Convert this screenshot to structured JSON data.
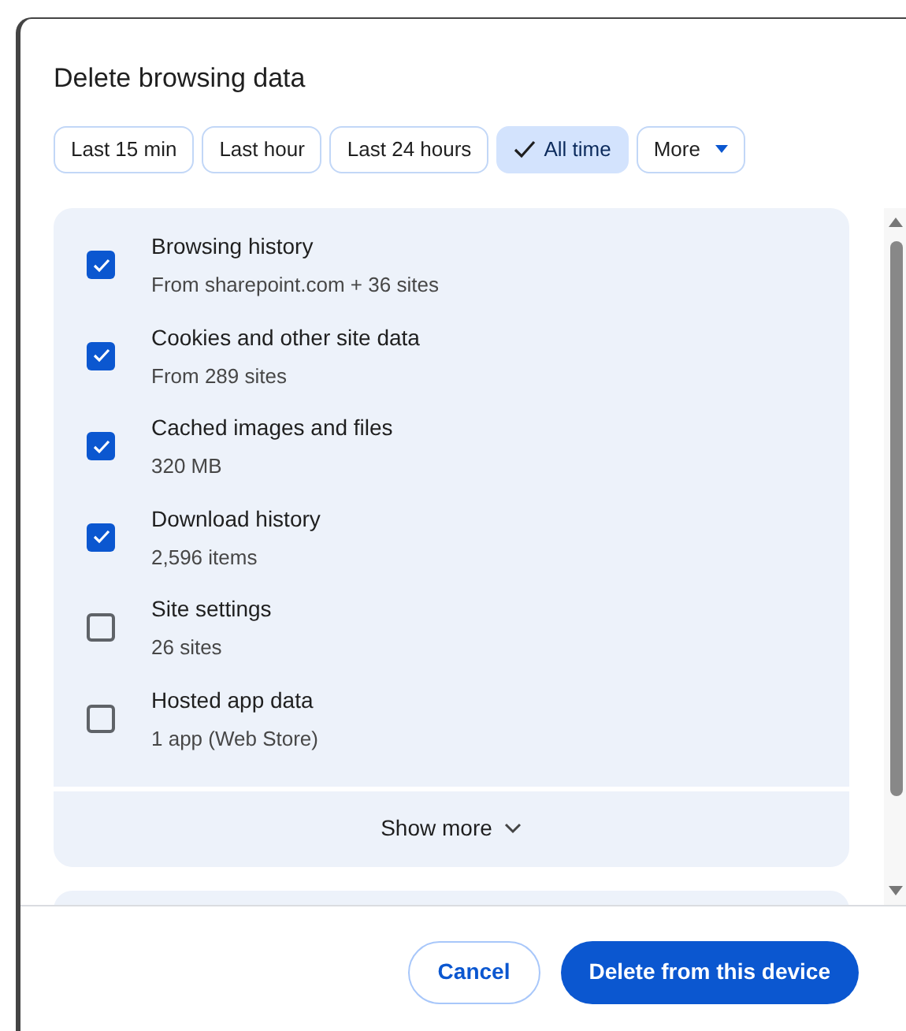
{
  "dialog": {
    "title": "Delete browsing data",
    "time_ranges": [
      {
        "label": "Last 15 min",
        "selected": false,
        "kind": "option"
      },
      {
        "label": "Last hour",
        "selected": false,
        "kind": "option"
      },
      {
        "label": "Last 24 hours",
        "selected": false,
        "kind": "option"
      },
      {
        "label": "All time",
        "selected": true,
        "kind": "option"
      },
      {
        "label": "More",
        "selected": false,
        "kind": "menu"
      }
    ],
    "items": [
      {
        "label": "Browsing history",
        "detail": "From sharepoint.com + 36 sites",
        "checked": true
      },
      {
        "label": "Cookies and other site data",
        "detail": "From 289 sites",
        "checked": true
      },
      {
        "label": "Cached images and files",
        "detail": "320 MB",
        "checked": true
      },
      {
        "label": "Download history",
        "detail": "2,596 items",
        "checked": true
      },
      {
        "label": "Site settings",
        "detail": "26 sites",
        "checked": false
      },
      {
        "label": "Hosted app data",
        "detail": "1 app (Web Store)",
        "checked": false
      }
    ],
    "show_more": "Show more",
    "buttons": {
      "cancel": "Cancel",
      "confirm": "Delete from this device"
    }
  }
}
